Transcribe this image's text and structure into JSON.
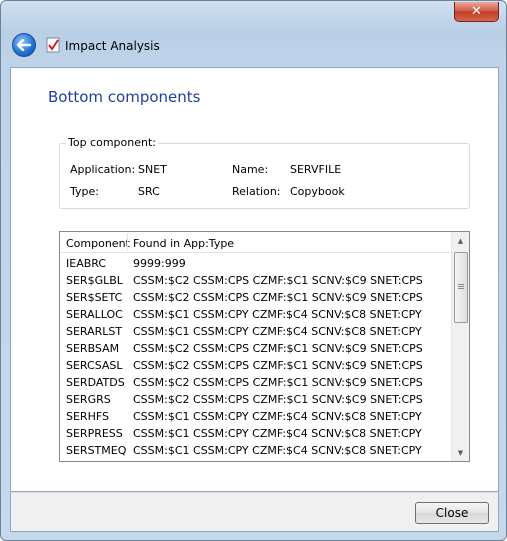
{
  "titlebar": {
    "close_glyph": "✕",
    "window_title": "Impact Analysis"
  },
  "page": {
    "heading": "Bottom components"
  },
  "top_component": {
    "legend": "Top component:",
    "application_label": "Application:",
    "application_value": "SNET",
    "name_label": "Name:",
    "name_value": "SERVFILE",
    "type_label": "Type:",
    "type_value": "SRC",
    "relation_label": "Relation:",
    "relation_value": "Copybook"
  },
  "list": {
    "columns": [
      "Component",
      "Found in App:Type"
    ],
    "rows": [
      {
        "component": "IEABRC",
        "found": "9999:999"
      },
      {
        "component": "SER$GLBL",
        "found": "CSSM:$C2 CSSM:CPS CZMF:$C1 SCNV:$C9 SNET:CPS"
      },
      {
        "component": "SER$SETC",
        "found": "CSSM:$C2 CSSM:CPS CZMF:$C1 SCNV:$C9 SNET:CPS"
      },
      {
        "component": "SERALLOC",
        "found": "CSSM:$C1 CSSM:CPY CZMF:$C4 SCNV:$C8 SNET:CPY"
      },
      {
        "component": "SERARLST",
        "found": "CSSM:$C1 CSSM:CPY CZMF:$C4 SCNV:$C8 SNET:CPY"
      },
      {
        "component": "SERBSAM",
        "found": "CSSM:$C2 CSSM:CPS CZMF:$C1 SCNV:$C9 SNET:CPS"
      },
      {
        "component": "SERCSASL",
        "found": "CSSM:$C2 CSSM:CPS CZMF:$C1 SCNV:$C9 SNET:CPS"
      },
      {
        "component": "SERDATDS",
        "found": "CSSM:$C2 CSSM:CPS CZMF:$C1 SCNV:$C9 SNET:CPS"
      },
      {
        "component": "SERGRS",
        "found": "CSSM:$C2 CSSM:CPS CZMF:$C1 SCNV:$C9 SNET:CPS"
      },
      {
        "component": "SERHFS",
        "found": "CSSM:$C1 CSSM:CPY CZMF:$C4 SCNV:$C8 SNET:CPY"
      },
      {
        "component": "SERPRESS",
        "found": "CSSM:$C1 CSSM:CPY CZMF:$C4 SCNV:$C8 SNET:CPY"
      },
      {
        "component": "SERSTMEQ",
        "found": "CSSM:$C1 CSSM:CPY CZMF:$C4 SCNV:$C8 SNET:CPY"
      }
    ]
  },
  "footer": {
    "close_label": "Close"
  },
  "colors": {
    "heading": "#1f3f9c",
    "titlebar": "#bed3e9",
    "close_red": "#c23a22"
  },
  "icons": {
    "back": "back-arrow-icon",
    "app": "checklist-icon",
    "window_close": "close-icon"
  }
}
